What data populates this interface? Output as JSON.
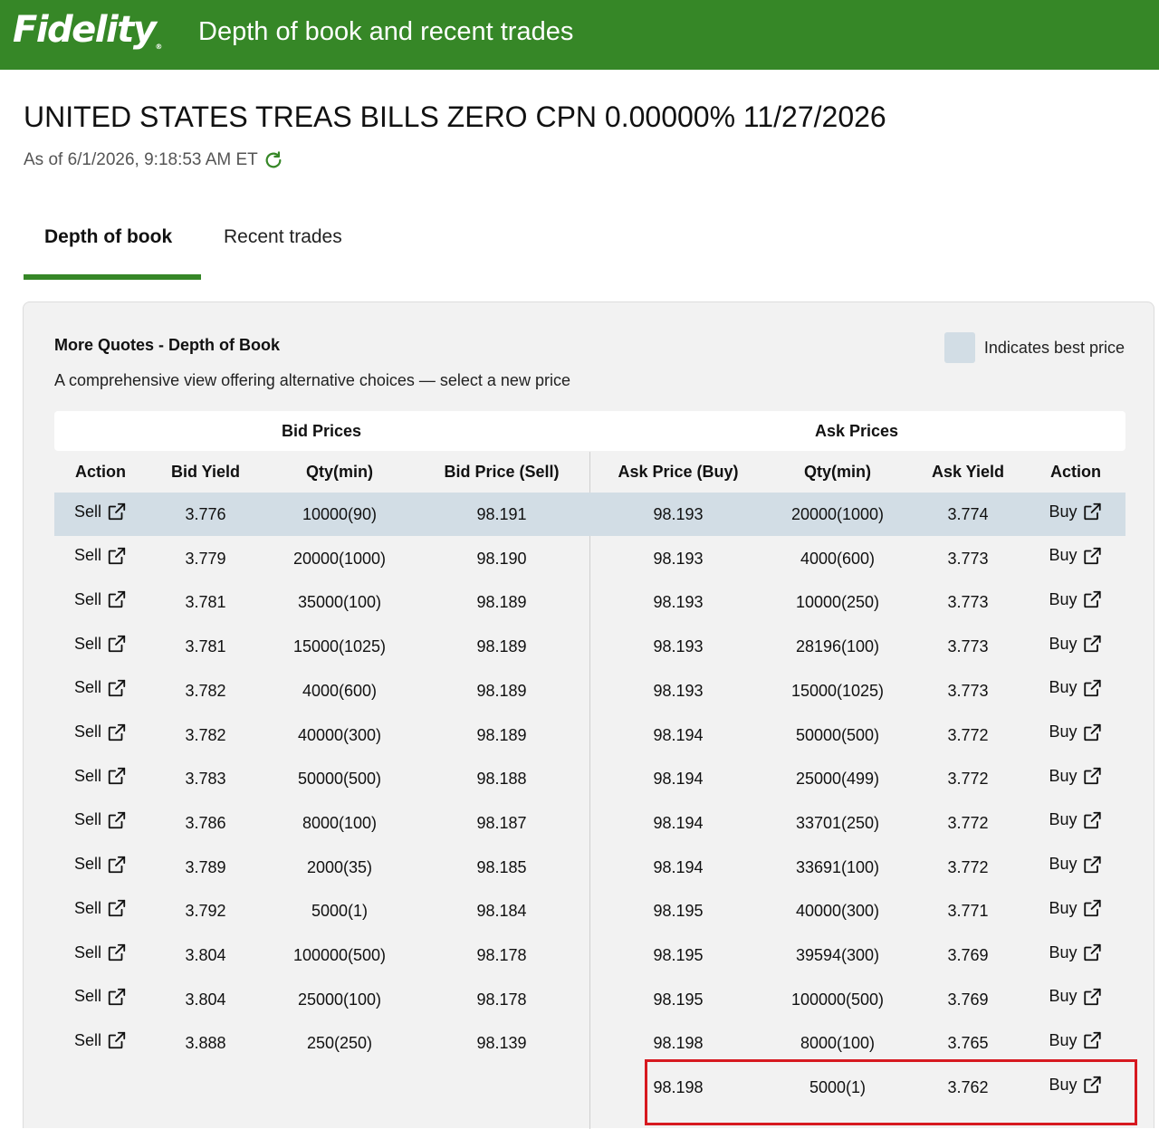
{
  "header": {
    "brand": "Fidelity",
    "brand_reg": "®",
    "title": "Depth of book and recent trades"
  },
  "security": {
    "name": "UNITED STATES TREAS BILLS ZERO CPN 0.00000% 11/27/2026",
    "as_of": "As of 6/1/2026, 9:18:53 AM ET"
  },
  "tabs": [
    {
      "label": "Depth of book",
      "active": true
    },
    {
      "label": "Recent trades",
      "active": false
    }
  ],
  "panel": {
    "title": "More Quotes - Depth of Book",
    "description": "A comprehensive view offering alternative choices — select a new price",
    "legend_label": "Indicates best price"
  },
  "table": {
    "bid_group": "Bid Prices",
    "ask_group": "Ask Prices",
    "columns": [
      "Action",
      "Bid Yield",
      "Qty(min)",
      "Bid Price (Sell)",
      "Ask Price (Buy)",
      "Qty(min)",
      "Ask Yield",
      "Action"
    ],
    "bid_action_label": "Sell",
    "ask_action_label": "Buy",
    "bids": [
      {
        "yield": "3.776",
        "qty": "10000(90)",
        "price": "98.191"
      },
      {
        "yield": "3.779",
        "qty": "20000(1000)",
        "price": "98.190"
      },
      {
        "yield": "3.781",
        "qty": "35000(100)",
        "price": "98.189"
      },
      {
        "yield": "3.781",
        "qty": "15000(1025)",
        "price": "98.189"
      },
      {
        "yield": "3.782",
        "qty": "4000(600)",
        "price": "98.189"
      },
      {
        "yield": "3.782",
        "qty": "40000(300)",
        "price": "98.189"
      },
      {
        "yield": "3.783",
        "qty": "50000(500)",
        "price": "98.188"
      },
      {
        "yield": "3.786",
        "qty": "8000(100)",
        "price": "98.187"
      },
      {
        "yield": "3.789",
        "qty": "2000(35)",
        "price": "98.185"
      },
      {
        "yield": "3.792",
        "qty": "5000(1)",
        "price": "98.184"
      },
      {
        "yield": "3.804",
        "qty": "100000(500)",
        "price": "98.178"
      },
      {
        "yield": "3.804",
        "qty": "25000(100)",
        "price": "98.178"
      },
      {
        "yield": "3.888",
        "qty": "250(250)",
        "price": "98.139"
      }
    ],
    "asks": [
      {
        "price": "98.193",
        "qty": "20000(1000)",
        "yield": "3.774"
      },
      {
        "price": "98.193",
        "qty": "4000(600)",
        "yield": "3.773"
      },
      {
        "price": "98.193",
        "qty": "10000(250)",
        "yield": "3.773"
      },
      {
        "price": "98.193",
        "qty": "28196(100)",
        "yield": "3.773"
      },
      {
        "price": "98.193",
        "qty": "15000(1025)",
        "yield": "3.773"
      },
      {
        "price": "98.194",
        "qty": "50000(500)",
        "yield": "3.772"
      },
      {
        "price": "98.194",
        "qty": "25000(499)",
        "yield": "3.772"
      },
      {
        "price": "98.194",
        "qty": "33701(250)",
        "yield": "3.772"
      },
      {
        "price": "98.194",
        "qty": "33691(100)",
        "yield": "3.772"
      },
      {
        "price": "98.195",
        "qty": "40000(300)",
        "yield": "3.771"
      },
      {
        "price": "98.195",
        "qty": "39594(300)",
        "yield": "3.769"
      },
      {
        "price": "98.195",
        "qty": "100000(500)",
        "yield": "3.769"
      },
      {
        "price": "98.198",
        "qty": "8000(100)",
        "yield": "3.765"
      },
      {
        "price": "98.198",
        "qty": "5000(1)",
        "yield": "3.762"
      }
    ]
  },
  "colors": {
    "brand_green": "#368727",
    "best_price": "#d2dde5",
    "highlight_red": "#d71920",
    "panel_bg": "#f2f2f2"
  }
}
